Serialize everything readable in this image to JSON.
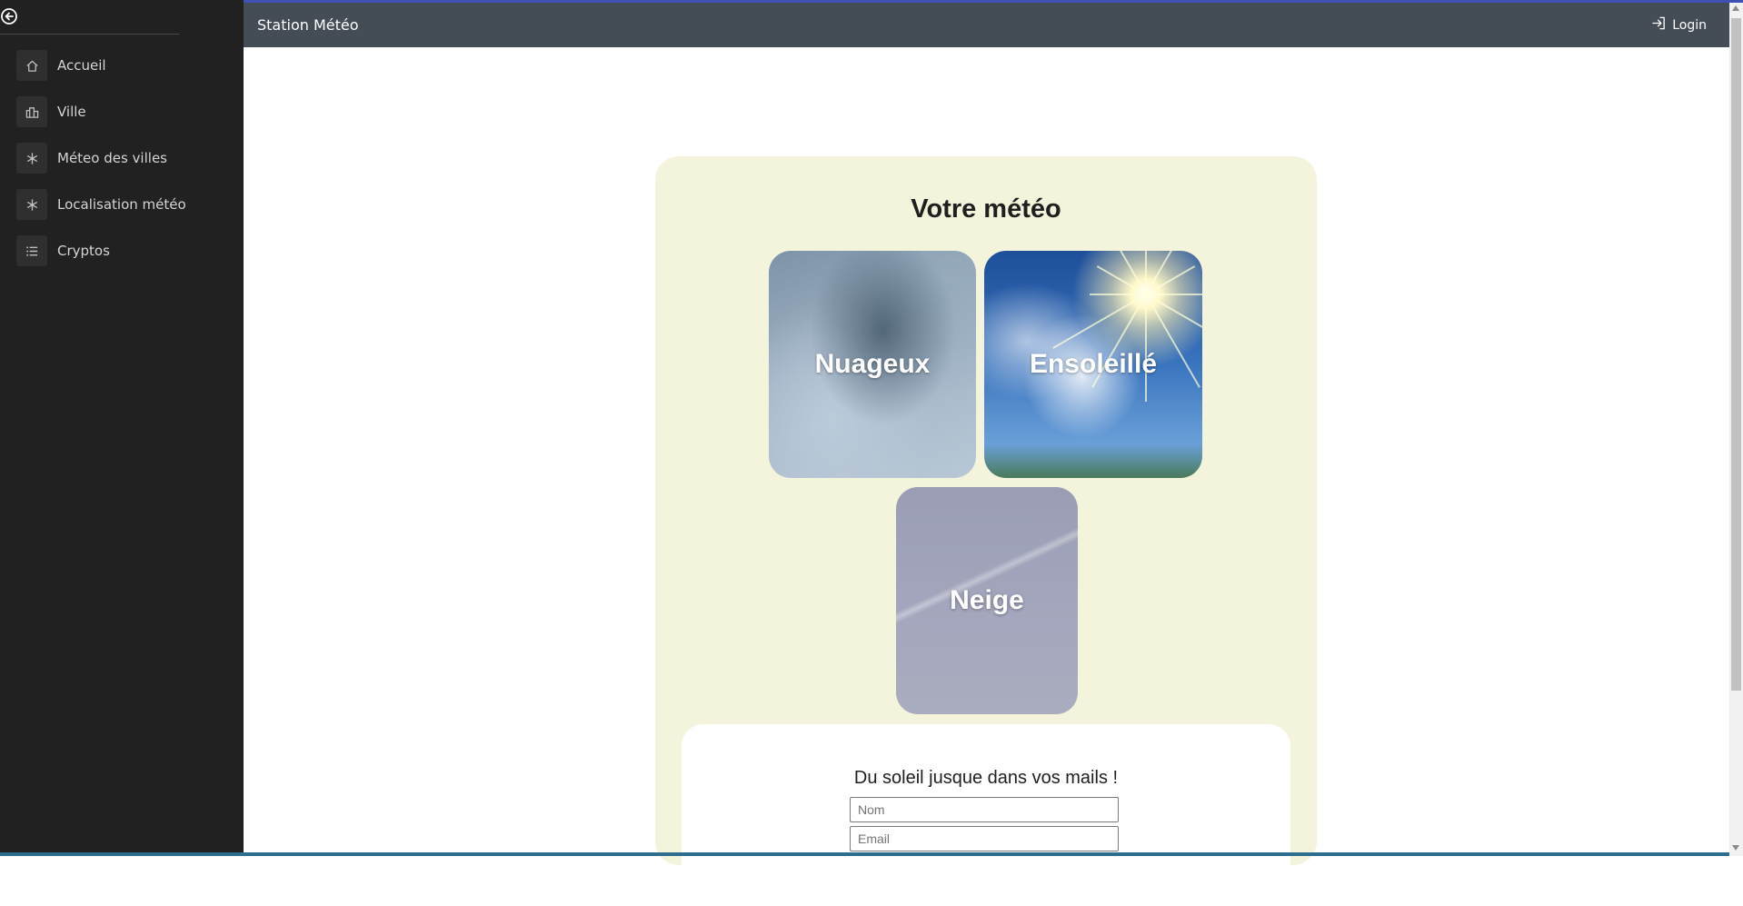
{
  "app": {
    "title": "Station Météo",
    "login_label": "Login"
  },
  "sidebar": {
    "items": [
      {
        "label": "Accueil",
        "icon": "home-icon"
      },
      {
        "label": "Ville",
        "icon": "city-icon"
      },
      {
        "label": "Méteo des villes",
        "icon": "snowflake-icon"
      },
      {
        "label": "Localisation météo",
        "icon": "snowflake-icon"
      },
      {
        "label": "Cryptos",
        "icon": "list-icon"
      }
    ]
  },
  "main": {
    "title": "Votre météo",
    "tiles": [
      {
        "label": "Nuageux"
      },
      {
        "label": "Ensoleillé"
      },
      {
        "label": "Neige"
      }
    ],
    "newsletter": {
      "title": "Du soleil jusque dans vos mails !",
      "name_placeholder": "Nom",
      "email_placeholder": "Email"
    }
  },
  "colors": {
    "sidebar_bg": "#212121",
    "topbar_bg": "#444c56",
    "card_bg": "#f4f4dc"
  }
}
